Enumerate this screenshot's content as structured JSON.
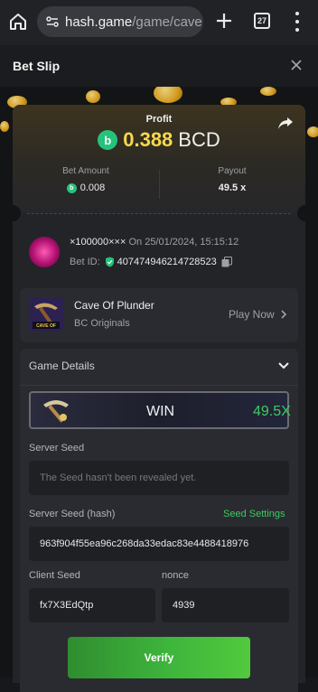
{
  "browser": {
    "url_host": "hash.game",
    "url_path": "/game/cave",
    "tab_count": "27"
  },
  "header": {
    "title": "Bet Slip"
  },
  "summary": {
    "profit_label": "Profit",
    "profit_value": "0.388",
    "currency": "BCD",
    "currency_icon_letter": "b",
    "bet_amount_label": "Bet Amount",
    "bet_amount": "0.008",
    "payout_label": "Payout",
    "payout": "49.5 x"
  },
  "user": {
    "name": "×100000×××",
    "on_text": "On 25/01/2024, 15:15:12",
    "bet_id_label": "Bet ID:",
    "bet_id": "407474946214728523"
  },
  "game": {
    "name": "Cave Of Plunder",
    "provider": "BC Originals",
    "play_now": "Play Now"
  },
  "details": {
    "title": "Game Details",
    "result_text": "WIN",
    "result_multiplier": "49.5X",
    "server_seed_label": "Server Seed",
    "server_seed_placeholder": "The Seed hasn't been revealed yet.",
    "server_seed_hash_label": "Server Seed (hash)",
    "seed_settings_label": "Seed Settings",
    "server_seed_hash": "963f904f55ea96c268da33edac83e4488418976",
    "client_seed_label": "Client Seed",
    "client_seed": "fx7X3EdQtp",
    "nonce_label": "nonce",
    "nonce": "4939",
    "verify_label": "Verify"
  },
  "colors": {
    "accent_green": "#3ccc5f",
    "profit_gold": "#f7d94d",
    "currency_green": "#26c27b"
  }
}
